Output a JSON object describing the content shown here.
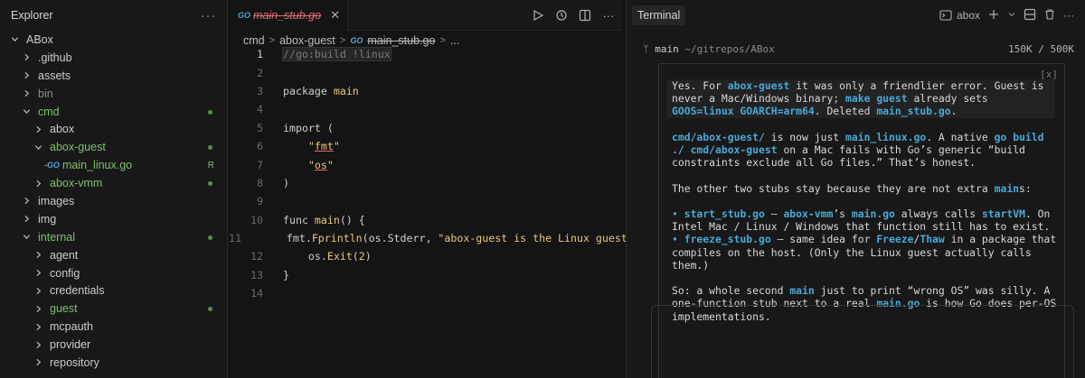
{
  "explorer": {
    "title": "Explorer",
    "more": "···",
    "items": [
      {
        "label": "ABox",
        "depth": 0,
        "type": "folder-open"
      },
      {
        "label": ".github",
        "depth": 1,
        "type": "folder"
      },
      {
        "label": "assets",
        "depth": 1,
        "type": "folder"
      },
      {
        "label": "bin",
        "depth": 1,
        "type": "folder",
        "dim": true
      },
      {
        "label": "cmd",
        "depth": 1,
        "type": "folder-open",
        "green": true,
        "dot": true
      },
      {
        "label": "abox",
        "depth": 2,
        "type": "folder"
      },
      {
        "label": "abox-guest",
        "depth": 2,
        "type": "folder-open",
        "green": true,
        "dot": true
      },
      {
        "label": "main_linux.go",
        "depth": 3,
        "type": "go-file",
        "green": true,
        "badge": "R"
      },
      {
        "label": "abox-vmm",
        "depth": 2,
        "type": "folder",
        "green": true,
        "dot": true
      },
      {
        "label": "images",
        "depth": 1,
        "type": "folder"
      },
      {
        "label": "img",
        "depth": 1,
        "type": "folder"
      },
      {
        "label": "internal",
        "depth": 1,
        "type": "folder-open",
        "green": true,
        "dot": true
      },
      {
        "label": "agent",
        "depth": 2,
        "type": "folder"
      },
      {
        "label": "config",
        "depth": 2,
        "type": "folder"
      },
      {
        "label": "credentials",
        "depth": 2,
        "type": "folder"
      },
      {
        "label": "guest",
        "depth": 2,
        "type": "folder",
        "green": true,
        "dot": true
      },
      {
        "label": "mcpauth",
        "depth": 2,
        "type": "folder"
      },
      {
        "label": "provider",
        "depth": 2,
        "type": "folder"
      },
      {
        "label": "repository",
        "depth": 2,
        "type": "folder"
      }
    ]
  },
  "editor": {
    "tab": {
      "icon": "GO",
      "name": "main_stub.go",
      "close": "✕"
    },
    "breadcrumb": {
      "parts": [
        "cmd",
        "abox-guest"
      ],
      "icon": "GO",
      "file": "main_stub.go",
      "more": "..."
    },
    "line_numbers": [
      "1",
      "2",
      "3",
      "4",
      "5",
      "6",
      "7",
      "8",
      "9",
      "10",
      "11",
      "12",
      "13",
      "14"
    ],
    "code": {
      "l1": "//go:build !linux",
      "l3a": "package ",
      "l3b": "main",
      "l5": "import (",
      "l6a": "    \"",
      "l6b": "fmt",
      "l6c": "\"",
      "l7a": "    \"",
      "l7b": "os",
      "l7c": "\"",
      "l8": ")",
      "l10a": "func ",
      "l10b": "main",
      "l10c": "() {",
      "l11a": "    fmt.",
      "l11b": "Fprintln",
      "l11c": "(os.Stderr, ",
      "l11d": "\"abox-guest is the Linux guest",
      "l12a": "    os.",
      "l12b": "Exit",
      "l12c": "(",
      "l12d": "2",
      "l12e": ")",
      "l13": "}"
    }
  },
  "terminal": {
    "tab": "Terminal",
    "profile": "abox",
    "prompt": {
      "branch": "main",
      "path": "~/gitrepos/ABox",
      "tokens": "150K / 500K"
    },
    "close_x": "[x]",
    "p1": {
      "a": "Yes. For ",
      "b": "abox-guest",
      "c": " it was only a friendlier error. Guest is never a Mac/Windows binary; ",
      "d": "make guest",
      "e": " already sets ",
      "f": "GOOS=linux GOARCH=arm64",
      "g": ". Deleted ",
      "h": "main_stub.go",
      "i": "."
    },
    "p2": {
      "a": "cmd/abox-guest/",
      "b": " is now just ",
      "c": "main_linux.go",
      "d": ". A native ",
      "e": "go build ./ cmd/abox-guest",
      "f": " on a Mac fails with Go’s generic “build constraints exclude all Go files.” That’s honest."
    },
    "p3": {
      "a": "The other two stubs stay because they are not extra ",
      "b": "main",
      "c": "s:"
    },
    "p4": {
      "bullet": "•",
      "a": "start_stub.go",
      "b": " — ",
      "c": "abox-vmm",
      "d": "’s ",
      "e": "main.go",
      "f": " always calls ",
      "g": "startVM",
      "h": ". On Intel Mac / Linux / Windows that function still has to exist."
    },
    "p5": {
      "bullet": "•",
      "a": "freeze_stub.go",
      "b": " — same idea for ",
      "c": "Freeze",
      "d": "/",
      "e": "Thaw",
      "f": " in a package that compiles on the host. (Only the Linux guest actually calls them.)"
    },
    "p6": {
      "a": "So: a whole second ",
      "b": "main",
      "c": " just to print “wrong OS” was silly. A one-function stub next to a real ",
      "d": "main.go",
      "e": " is how Go does per-OS implementations."
    }
  }
}
